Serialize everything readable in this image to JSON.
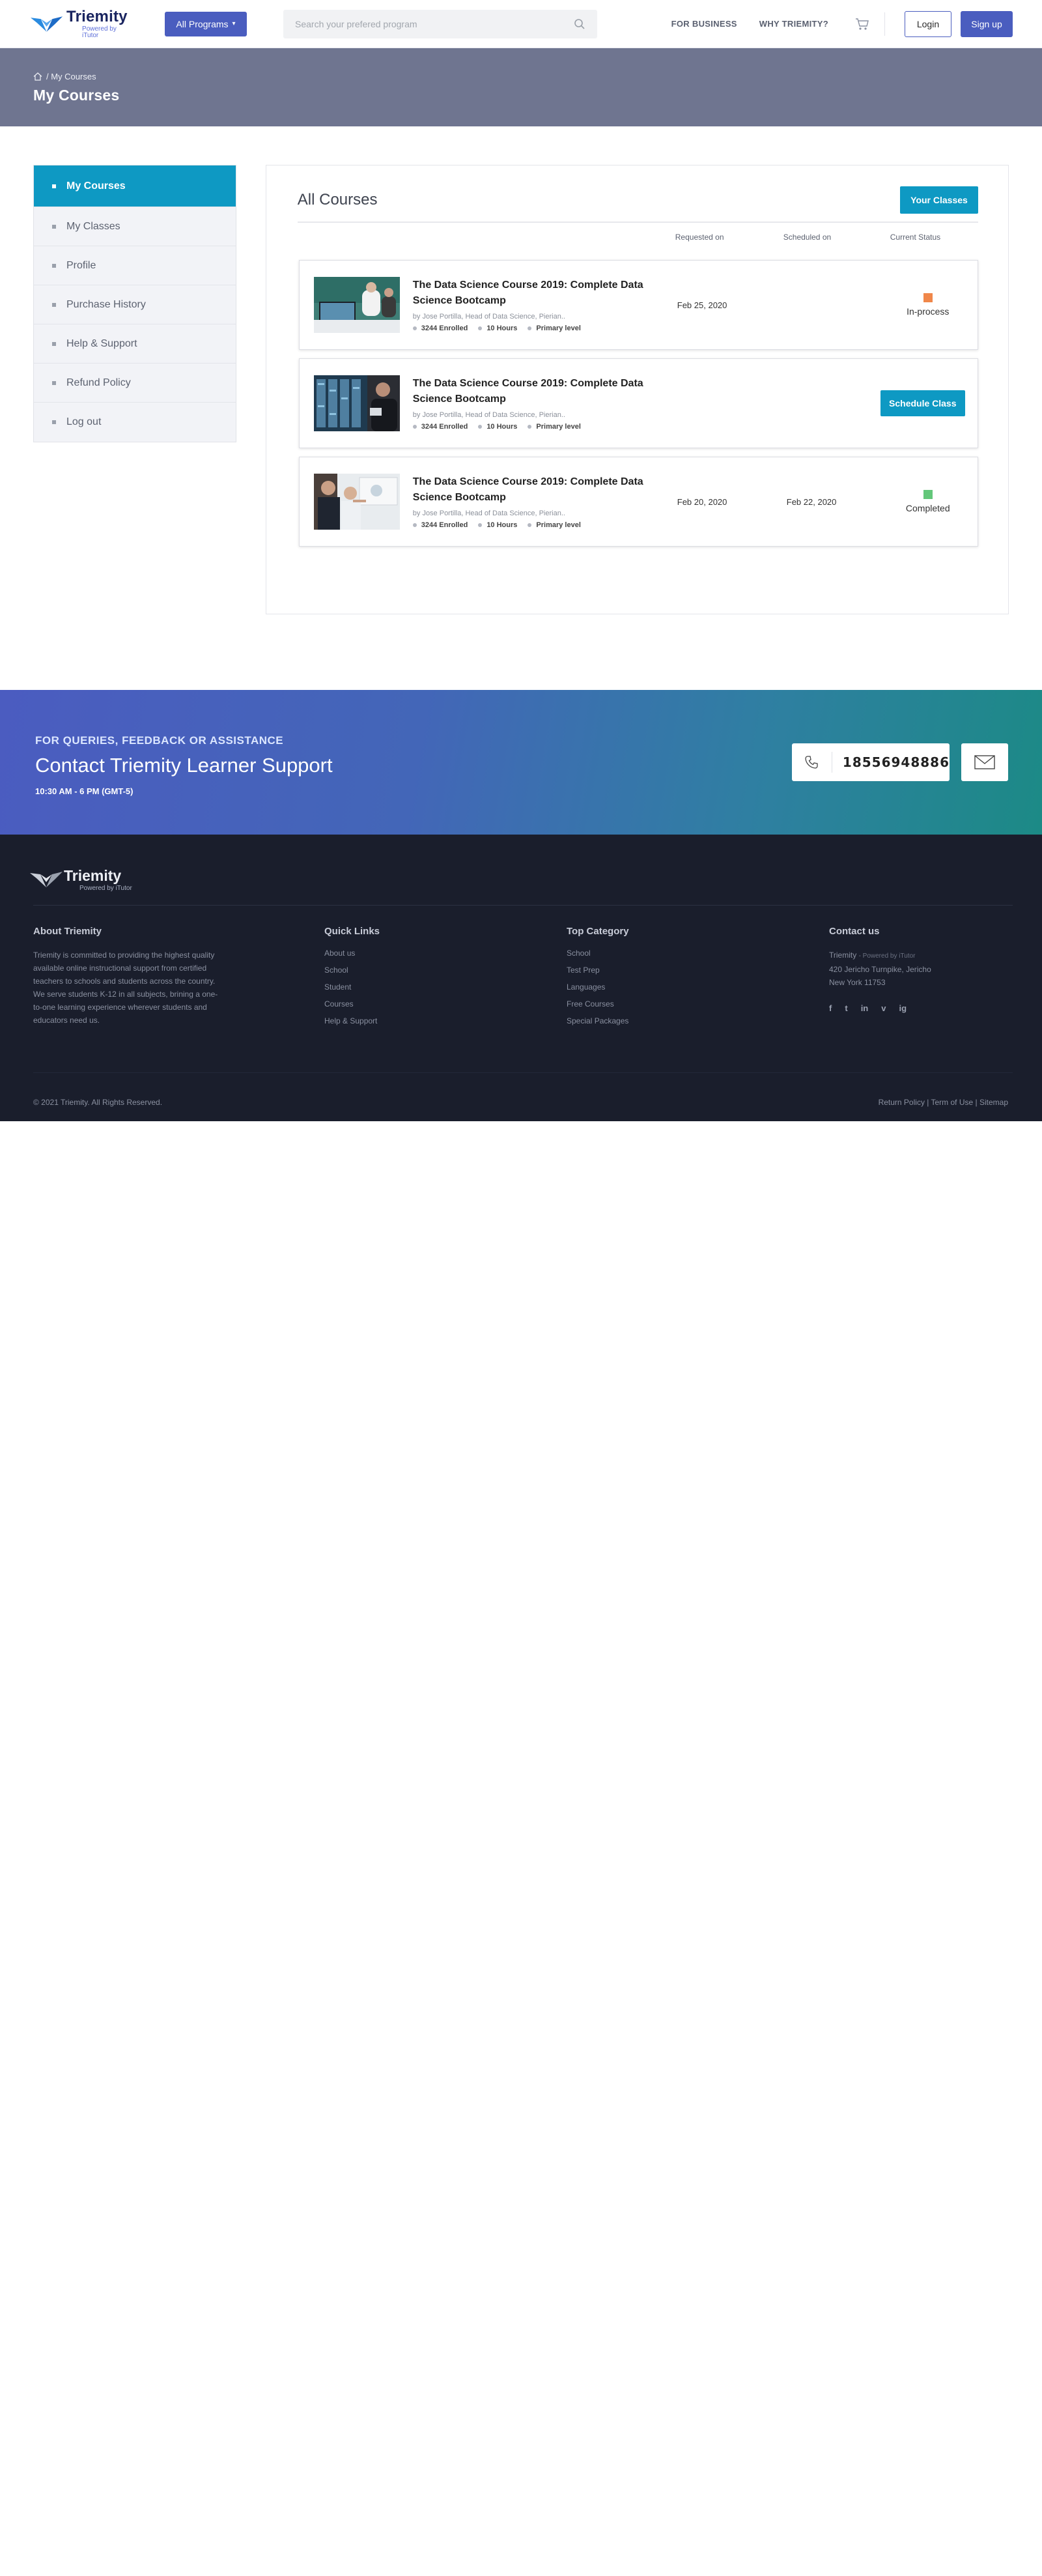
{
  "brand": {
    "name": "Triemity",
    "tagline": "Powered by iTutor"
  },
  "header": {
    "programs_label": "All Programs",
    "search_placeholder": "Search your prefered program",
    "nav": [
      "FOR BUSINESS",
      "WHY TRIEMITY?"
    ],
    "login_label": "Login",
    "signup_label": "Sign up"
  },
  "banner": {
    "crumb_current": "/ My Courses",
    "title": "My Courses"
  },
  "sidebar": {
    "items": [
      {
        "label": "My Courses"
      },
      {
        "label": "My Classes"
      },
      {
        "label": "Profile"
      },
      {
        "label": "Purchase History"
      },
      {
        "label": "Help & Support"
      },
      {
        "label": "Refund Policy"
      },
      {
        "label": "Log out"
      }
    ]
  },
  "content": {
    "title": "All Courses",
    "your_classes_label": "Your Classes",
    "columns": {
      "requested": "Requested on",
      "scheduled": "Scheduled on",
      "status": "Current Status"
    },
    "courses": [
      {
        "title": "The Data Science Course 2019: Complete Data Science Bootcamp",
        "author": "by Jose Portilla, Head of Data Science, Pierian..",
        "enrolled": "3244 Enrolled",
        "hours": "10 Hours",
        "level": "Primary level",
        "requested": "Feb 25, 2020",
        "scheduled": "",
        "status": "In-process",
        "status_color": "#f0874a"
      },
      {
        "title": "The Data Science Course 2019: Complete Data Science Bootcamp",
        "author": "by Jose Portilla, Head of Data Science, Pierian..",
        "enrolled": "3244 Enrolled",
        "hours": "10 Hours",
        "level": "Primary level",
        "action_label": "Schedule Class"
      },
      {
        "title": "The Data Science Course 2019: Complete Data Science Bootcamp",
        "author": "by Jose Portilla, Head of Data Science, Pierian..",
        "enrolled": "3244 Enrolled",
        "hours": "10 Hours",
        "level": "Primary level",
        "requested": "Feb 20, 2020",
        "scheduled": "Feb 22, 2020",
        "status": "Completed",
        "status_color": "#63c77a"
      }
    ]
  },
  "contact": {
    "kicker": "FOR QUERIES, FEEDBACK OR ASSISTANCE",
    "headline": "Contact Triemity Learner Support",
    "hours": "10:30 AM - 6 PM (GMT-5)",
    "phone": "18556948886"
  },
  "footer": {
    "about": {
      "title": "About Triemity",
      "text": "Triemity is committed to providing the highest quality available online instructional support from certified teachers to schools and students across the country. We serve students K-12 in all subjects, brining a one-to-one learning experience wherever students and educators need us."
    },
    "quick_links": {
      "title": "Quick Links",
      "items": [
        "About us",
        "School",
        "Student",
        "Courses",
        "Help & Support"
      ]
    },
    "top_category": {
      "title": "Top Category",
      "items": [
        "School",
        "Test Prep",
        "Languages",
        "Free Courses",
        "Special Packages"
      ]
    },
    "contact": {
      "title": "Contact us",
      "company": "Triemity",
      "company_sub": "- Powered by iTutor",
      "address1": "420 Jericho Turnpike, Jericho",
      "address2": "New York 11753",
      "social": [
        "f",
        "t",
        "in",
        "v",
        "ig"
      ]
    },
    "copyright": "© 2021 Triemity. All Rights Reserved.",
    "bottom_links": "Return Policy | Term of Use | Sitemap"
  },
  "colors": {
    "primary": "#4a5dbf",
    "accent": "#0e99c3",
    "footer_bg": "#1a1e2c"
  }
}
